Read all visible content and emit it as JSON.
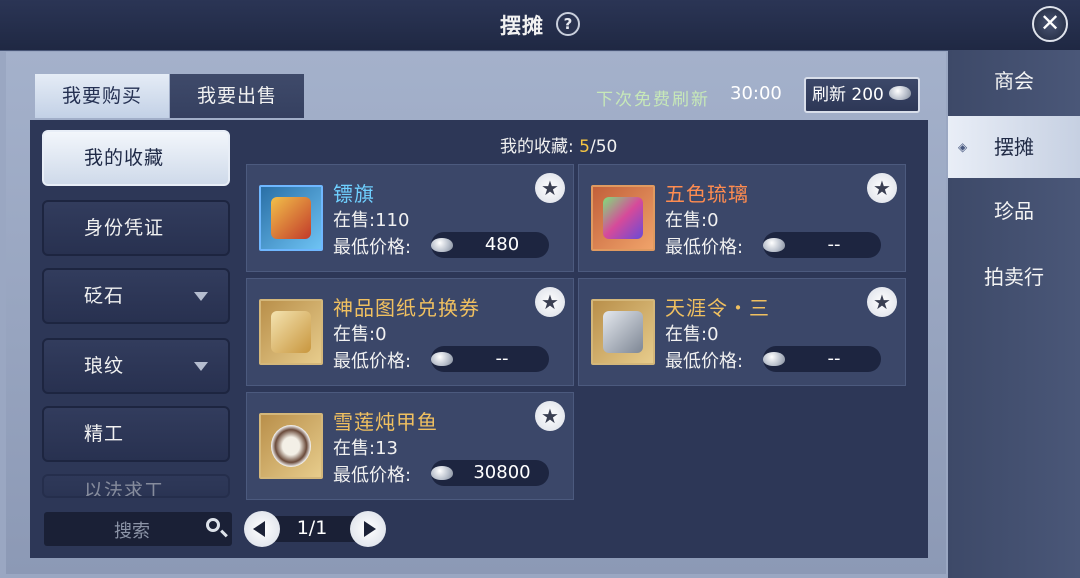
{
  "header": {
    "title": "摆摊",
    "help_icon": "?",
    "close_icon": "✕"
  },
  "right_nav": {
    "items": [
      {
        "label": "商会"
      },
      {
        "label": "摆摊",
        "active": true
      },
      {
        "label": "珍品"
      },
      {
        "label": "拍卖行"
      }
    ]
  },
  "tabs": {
    "buy": "我要购买",
    "sell": "我要出售"
  },
  "refresh": {
    "label": "下次免费刷新",
    "timer": "30:00",
    "button_label": "刷新 200"
  },
  "categories": [
    {
      "label": "我的收藏",
      "active": true
    },
    {
      "label": "身份凭证"
    },
    {
      "label": "砭石",
      "has_dropdown": true
    },
    {
      "label": "琅纹",
      "has_dropdown": true
    },
    {
      "label": "精工"
    },
    {
      "label": "以法求工"
    }
  ],
  "search": {
    "placeholder": "搜索"
  },
  "pager": {
    "text": "1/1"
  },
  "favorites": {
    "label": "我的收藏:",
    "count": "5",
    "total": "/50"
  },
  "price_label": "最低价格:",
  "items": [
    {
      "name": "镖旗",
      "stock": "在售:110",
      "price": "480",
      "rarity_color": "#6fd0ff",
      "icon": "flag-icon"
    },
    {
      "name": "五色琉璃",
      "stock": "在售:0",
      "price": "--",
      "rarity_color": "#ff8c50",
      "icon": "crystal-icon"
    },
    {
      "name": "神品图纸兑换券",
      "stock": "在售:0",
      "price": "--",
      "rarity_color": "#f0c060",
      "icon": "scroll-icon"
    },
    {
      "name": "天涯令・三",
      "stock": "在售:0",
      "price": "--",
      "rarity_color": "#f0c060",
      "icon": "token-icon"
    },
    {
      "name": "雪莲炖甲鱼",
      "stock": "在售:13",
      "price": "30800",
      "rarity_color": "#f0c060",
      "icon": "soup-bowl-icon"
    }
  ]
}
